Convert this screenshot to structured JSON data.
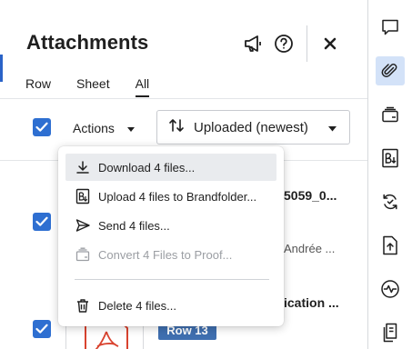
{
  "panel": {
    "title": "Attachments",
    "tabs": [
      {
        "label": "Row",
        "active": false
      },
      {
        "label": "Sheet",
        "active": false
      },
      {
        "label": "All",
        "active": true
      }
    ]
  },
  "toolbar": {
    "select_all_checked": true,
    "actions_label": "Actions",
    "sort_label": "Uploaded (newest)"
  },
  "menu": {
    "items": [
      {
        "label": "Download 4 files...",
        "icon": "download-icon",
        "state": "hover"
      },
      {
        "label": "Upload 4 files to Brandfolder...",
        "icon": "brandfolder-icon",
        "state": "normal"
      },
      {
        "label": "Send 4 files...",
        "icon": "send-icon",
        "state": "normal"
      },
      {
        "label": "Convert 4 Files to Proof...",
        "icon": "proof-icon",
        "state": "disabled"
      },
      {
        "label": "Delete 4 files...",
        "icon": "trash-icon",
        "state": "normal"
      }
    ]
  },
  "rows": [
    {
      "checked": true,
      "name_fragment": "5059_0...",
      "uploader_fragment": "Andrée ..."
    },
    {
      "checked": true,
      "name_fragment": "ication ...",
      "row_tag": "Row 13"
    }
  ],
  "rail": {
    "icons": [
      "comment-icon",
      "attachment-icon",
      "proof-card-icon",
      "brandfolder-icon",
      "update-requests-icon",
      "upload-icon",
      "activity-icon",
      "summary-icon"
    ],
    "active": "attachment-icon"
  },
  "colors": {
    "accent": "#2e6fd1",
    "rail_active_bg": "#d3e2f8",
    "row_tag_bg": "#3f6fb0",
    "menu_hover_bg": "#e9ebee",
    "pdf_red": "#d9432f"
  }
}
